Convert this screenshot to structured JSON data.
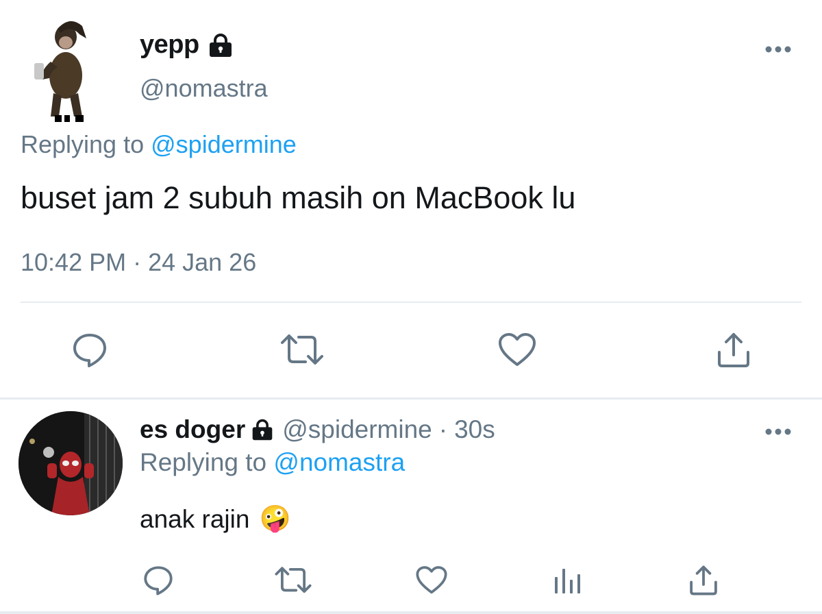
{
  "tweet": {
    "display_name": "yepp",
    "handle": "@nomastra",
    "replying_prefix": "Replying to",
    "replying_to": "@spidermine",
    "text": "buset jam 2 subuh masih on MacBook lu",
    "timestamp": "10:42 PM · 24 Jan 26",
    "actions": [
      "reply-icon",
      "retweet-icon",
      "like-icon",
      "share-icon"
    ],
    "more_icon": "more-icon",
    "locked": true
  },
  "reply": {
    "display_name": "es doger",
    "handle": "@spidermine",
    "separator": "·",
    "age": "30s",
    "replying_prefix": "Replying to",
    "replying_to": "@nomastra",
    "text": "anak rajin",
    "emoji": "🤪",
    "actions": [
      "reply-icon",
      "retweet-icon",
      "like-icon",
      "analytics-icon",
      "share-icon"
    ],
    "locked": true
  },
  "colors": {
    "text": "#14171a",
    "muted": "#657786",
    "link": "#1da1f2",
    "divider": "#e6ecf0"
  }
}
